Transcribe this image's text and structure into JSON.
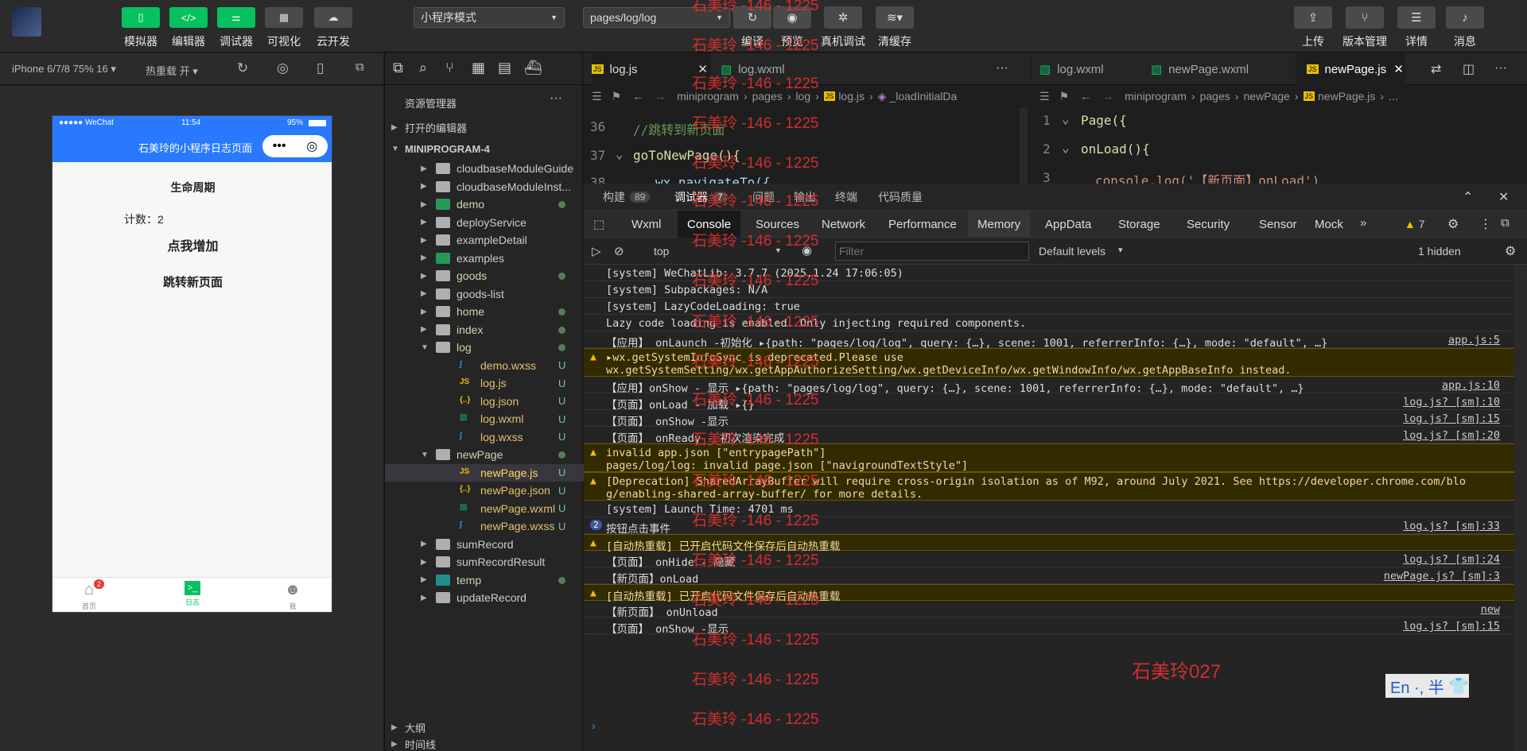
{
  "toolbar": {
    "left_buttons": [
      "模拟器",
      "编辑器",
      "调试器",
      "可视化",
      "云开发"
    ],
    "mode_select": "小程序模式",
    "page_select": "pages/log/log",
    "mid_buttons": [
      "编译",
      "预览",
      "真机调试",
      "清缓存"
    ],
    "right_buttons": [
      "上传",
      "版本管理",
      "详情",
      "消息"
    ]
  },
  "simbar": {
    "device": "iPhone 6/7/8 75% 16 ▾",
    "hot_reload": "热重载 开 ▾"
  },
  "phone": {
    "carrier": "●●●●● WeChat",
    "time": "11:54",
    "battery": "95%",
    "nav_title": "石美玲的小程序日志页面",
    "lifecycle": "生命周期",
    "count": "计数：2",
    "btn_add": "点我增加",
    "btn_jump": "跳转新页面",
    "tabs": [
      "首页",
      "日志",
      "我"
    ],
    "home_badge": "2"
  },
  "explorer": {
    "title": "资源管理器",
    "open_editors": "打开的编辑器",
    "project": "MINIPROGRAM-4",
    "items": [
      {
        "name": "cloudbaseModuleGuide",
        "type": "folder",
        "depth": 1
      },
      {
        "name": "cloudbaseModuleInst...",
        "type": "folder",
        "depth": 1
      },
      {
        "name": "demo",
        "type": "folder-green",
        "depth": 1,
        "dot": true
      },
      {
        "name": "deployService",
        "type": "folder",
        "depth": 1
      },
      {
        "name": "exampleDetail",
        "type": "folder",
        "depth": 1
      },
      {
        "name": "examples",
        "type": "folder-green",
        "depth": 1
      },
      {
        "name": "goods",
        "type": "folder",
        "depth": 1,
        "dot": true
      },
      {
        "name": "goods-list",
        "type": "folder",
        "depth": 1
      },
      {
        "name": "home",
        "type": "folder",
        "depth": 1,
        "dot": true
      },
      {
        "name": "index",
        "type": "folder",
        "depth": 1,
        "dot": true
      },
      {
        "name": "log",
        "type": "folder-open",
        "depth": 1,
        "dot": true
      },
      {
        "name": "demo.wxss",
        "type": "wxss",
        "depth": 2,
        "badge": "U"
      },
      {
        "name": "log.js",
        "type": "js",
        "depth": 2,
        "badge": "U"
      },
      {
        "name": "log.json",
        "type": "json",
        "depth": 2,
        "badge": "U"
      },
      {
        "name": "log.wxml",
        "type": "wxml",
        "depth": 2,
        "badge": "U"
      },
      {
        "name": "log.wxss",
        "type": "wxss",
        "depth": 2,
        "badge": "U"
      },
      {
        "name": "newPage",
        "type": "folder-open",
        "depth": 1,
        "dot": true
      },
      {
        "name": "newPage.js",
        "type": "js",
        "depth": 2,
        "badge": "U",
        "selected": true
      },
      {
        "name": "newPage.json",
        "type": "json",
        "depth": 2,
        "badge": "U"
      },
      {
        "name": "newPage.wxml",
        "type": "wxml",
        "depth": 2,
        "badge": "U"
      },
      {
        "name": "newPage.wxss",
        "type": "wxss",
        "depth": 2,
        "badge": "U"
      },
      {
        "name": "sumRecord",
        "type": "folder",
        "depth": 1
      },
      {
        "name": "sumRecordResult",
        "type": "folder",
        "depth": 1
      },
      {
        "name": "temp",
        "type": "folder-teal",
        "depth": 1,
        "dot": true
      },
      {
        "name": "updateRecord",
        "type": "folder",
        "depth": 1
      }
    ],
    "outline": "大纲",
    "timeline": "时间线"
  },
  "editor1": {
    "tabs": [
      "log.js",
      "log.wxml"
    ],
    "breadcrumb": [
      "miniprogram",
      "pages",
      "log",
      "log.js",
      "_loadInitialDa"
    ],
    "lines": [
      {
        "n": "36",
        "text": "//跳转到新页面"
      },
      {
        "n": "37",
        "text": "goToNewPage(){"
      },
      {
        "n": "38",
        "text": "wx.navigateTo({"
      }
    ]
  },
  "editor2": {
    "tabs": [
      "log.wxml",
      "newPage.wxml",
      "newPage.js"
    ],
    "breadcrumb": [
      "miniprogram",
      "pages",
      "newPage",
      "newPage.js",
      "..."
    ],
    "lines": [
      {
        "n": "1",
        "text": "Page({"
      },
      {
        "n": "2",
        "text": "onLoad(){"
      },
      {
        "n": "3",
        "text": "console.log('【新页面】onLoad')"
      }
    ]
  },
  "devtools": {
    "tabs": [
      {
        "label": "构建",
        "count": "89"
      },
      {
        "label": "调试器",
        "count": "7"
      },
      {
        "label": "问题"
      },
      {
        "label": "输出"
      },
      {
        "label": "终端"
      },
      {
        "label": "代码质量"
      }
    ],
    "panels": [
      "Wxml",
      "Console",
      "Sources",
      "Network",
      "Performance",
      "Memory",
      "AppData",
      "Storage",
      "Security",
      "Sensor",
      "Mock"
    ],
    "warn_count": "7",
    "context": "top",
    "filter_placeholder": "Filter",
    "levels": "Default levels",
    "hidden": "1 hidden",
    "logs": [
      {
        "text": "[system] WeChatLib: 3.7.7 (2025.1.24 17:06:05)",
        "src": ""
      },
      {
        "text": "[system] Subpackages: N/A",
        "src": ""
      },
      {
        "text": "[system] LazyCodeLoading: true",
        "src": ""
      },
      {
        "text": "Lazy code loading is enabled. Only injecting required components.",
        "src": ""
      },
      {
        "text": "【应用】 onLaunch -初始化 ▸{path: \"pages/log/log\", query: {…}, scene: 1001, referrerInfo: {…}, mode: \"default\", …}",
        "src": "app.js:5"
      },
      {
        "text": "▸wx.getSystemInfoSync is deprecated.Please use",
        "text2": "wx.getSystemSetting/wx.getAppAuthorizeSetting/wx.getDeviceInfo/wx.getWindowInfo/wx.getAppBaseInfo instead.",
        "src": "",
        "warn": true
      },
      {
        "text": "【应用】onShow - 显示 ▸{path: \"pages/log/log\", query: {…}, scene: 1001, referrerInfo: {…}, mode: \"default\", …}",
        "src": "app.js:10"
      },
      {
        "text": "【页面】onLoad - 加载 ▸{}",
        "src": "log.js? [sm]:10"
      },
      {
        "text": "【页面】 onShow -显示",
        "src": "log.js? [sm]:15"
      },
      {
        "text": "【页面】 onReady - 初次渲染完成",
        "src": "log.js? [sm]:20"
      },
      {
        "text": "invalid app.json [\"entrypagePath\"]",
        "text2": "pages/log/log: invalid page.json [\"navigroundTextStyle\"]",
        "src": "",
        "warn": true
      },
      {
        "text": "[Deprecation] SharedArrayBuffer will require cross-origin isolation as of M92, around July 2021. See https://developer.chrome.com/blo",
        "text2": "g/enabling-shared-array-buffer/ for more details.",
        "src": "",
        "warn": true
      },
      {
        "text": "[system] Launch Time: 4701 ms",
        "src": ""
      },
      {
        "text": "按钮点击事件",
        "src": "log.js? [sm]:33",
        "count": "2"
      },
      {
        "text": "[自动热重载] 已开启代码文件保存后自动热重载",
        "src": "",
        "warn": true
      },
      {
        "text": "【页面】 onHide - 隐藏",
        "src": "log.js? [sm]:24"
      },
      {
        "text": "【新页面】onLoad",
        "src": "newPage.js? [sm]:3"
      },
      {
        "text": "[自动热重载] 已开启代码文件保存后自动热重载",
        "src": "",
        "warn": true
      },
      {
        "text": "【新页面】 onUnload",
        "src": "new"
      },
      {
        "text": "【页面】 onShow -显示",
        "src": "log.js? [sm]:15"
      }
    ]
  },
  "watermark": "石美玲 -146 - 1225",
  "watermark_big": "石美玲027",
  "ime": "En ·, 半"
}
